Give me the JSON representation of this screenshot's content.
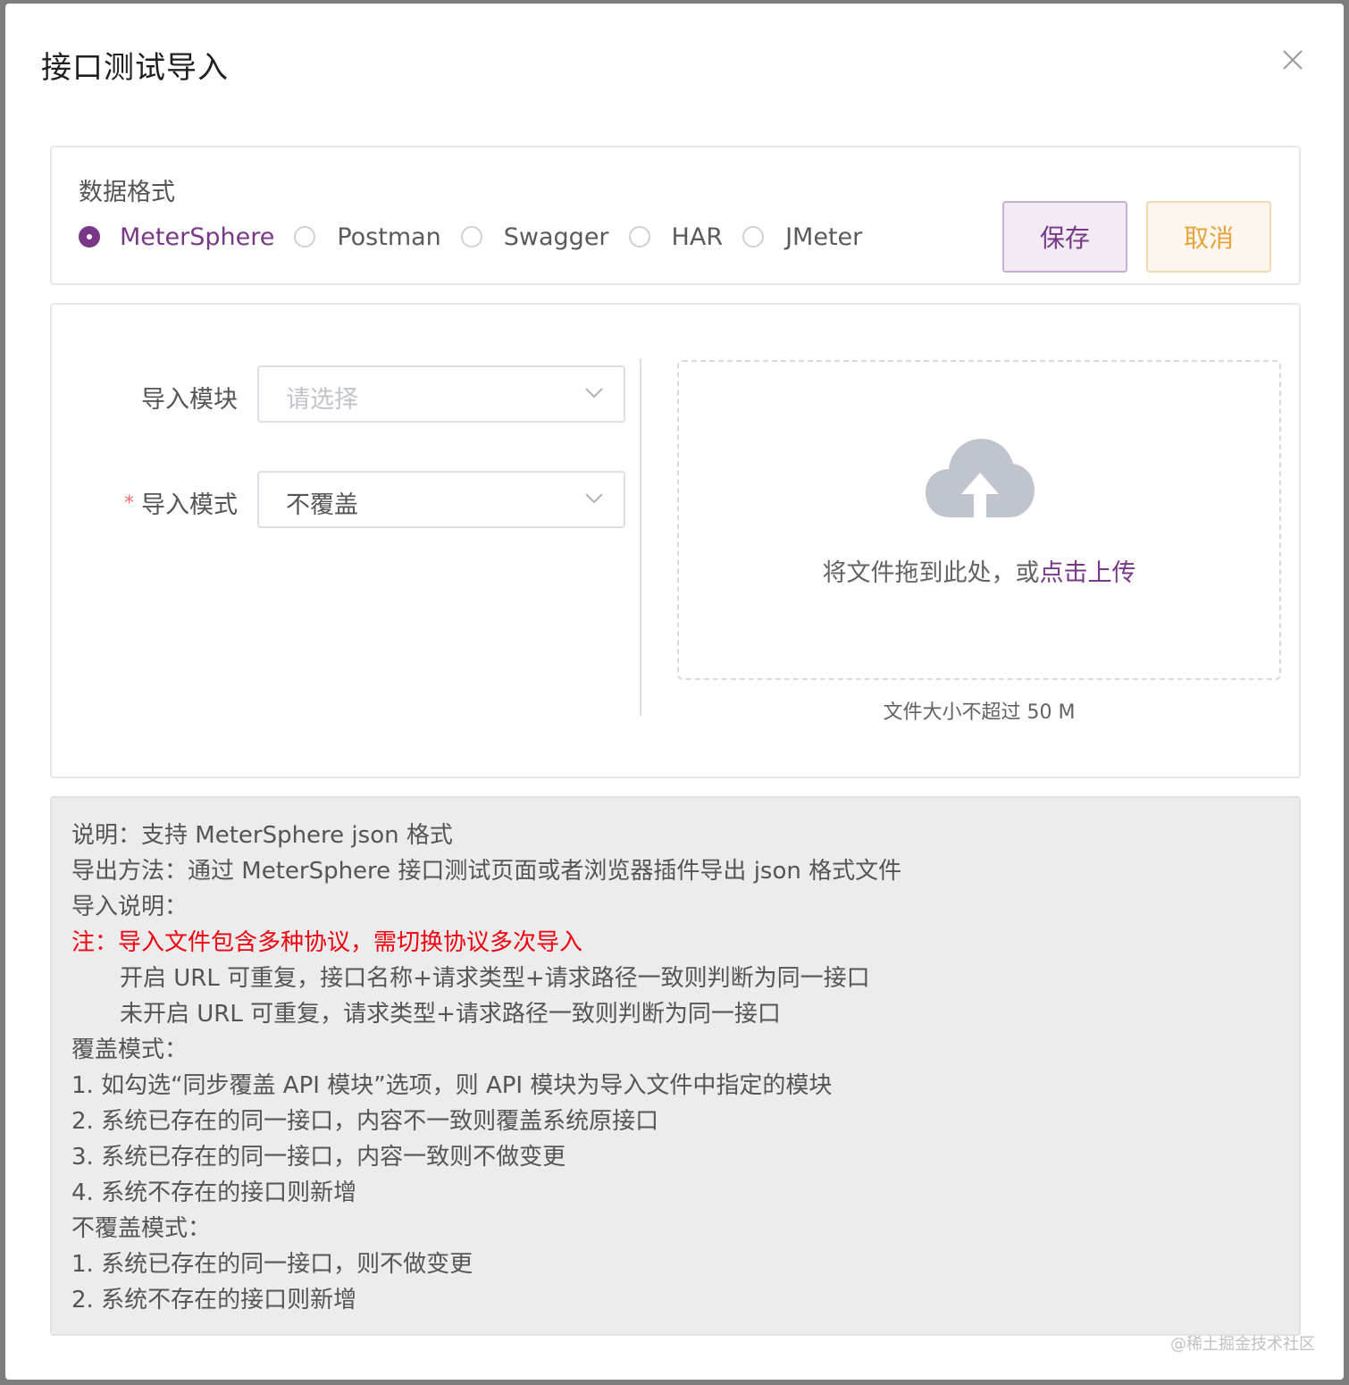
{
  "dialog": {
    "title": "接口测试导入"
  },
  "format": {
    "label": "数据格式",
    "options": [
      "MeterSphere",
      "Postman",
      "Swagger",
      "HAR",
      "JMeter"
    ],
    "selected": "MeterSphere"
  },
  "actions": {
    "save_label": "保存",
    "cancel_label": "取消"
  },
  "form": {
    "module_label": "导入模块",
    "module_placeholder": "请选择",
    "mode_label": "导入模式",
    "mode_required_mark": "*",
    "mode_value": "不覆盖"
  },
  "upload": {
    "text": "将文件拖到此处，或",
    "link": "点击上传",
    "tip": "文件大小不超过 50 M"
  },
  "notes": {
    "lines": [
      {
        "text": "说明：支持 MeterSphere json 格式",
        "style": "normal"
      },
      {
        "text": "导出方法：通过 MeterSphere 接口测试页面或者浏览器插件导出 json 格式文件",
        "style": "normal"
      },
      {
        "text": "导入说明：",
        "style": "normal"
      },
      {
        "text": "注：导入文件包含多种协议，需切换协议多次导入",
        "style": "red"
      },
      {
        "text": "开启 URL 可重复，接口名称+请求类型+请求路径一致则判断为同一接口",
        "style": "indent"
      },
      {
        "text": "未开启 URL 可重复，请求类型+请求路径一致则判断为同一接口",
        "style": "indent"
      },
      {
        "text": "覆盖模式：",
        "style": "normal"
      },
      {
        "text": "1. 如勾选“同步覆盖 API 模块”选项，则 API 模块为导入文件中指定的模块",
        "style": "normal"
      },
      {
        "text": "2. 系统已存在的同一接口，内容不一致则覆盖系统原接口",
        "style": "normal"
      },
      {
        "text": "3. 系统已存在的同一接口，内容一致则不做变更",
        "style": "normal"
      },
      {
        "text": "4. 系统不存在的接口则新增",
        "style": "normal"
      },
      {
        "text": "不覆盖模式：",
        "style": "normal"
      },
      {
        "text": "1. 系统已存在的同一接口，则不做变更",
        "style": "normal"
      },
      {
        "text": "2. 系统不存在的接口则新增",
        "style": "normal"
      }
    ]
  },
  "watermark": "@稀土掘金技术社区",
  "colors": {
    "accent": "#783887",
    "warning": "#e6a23c",
    "danger": "#f0000e"
  },
  "icons": {
    "close": "close-icon",
    "chevron": "chevron-down-icon",
    "upload": "cloud-upload-icon"
  }
}
